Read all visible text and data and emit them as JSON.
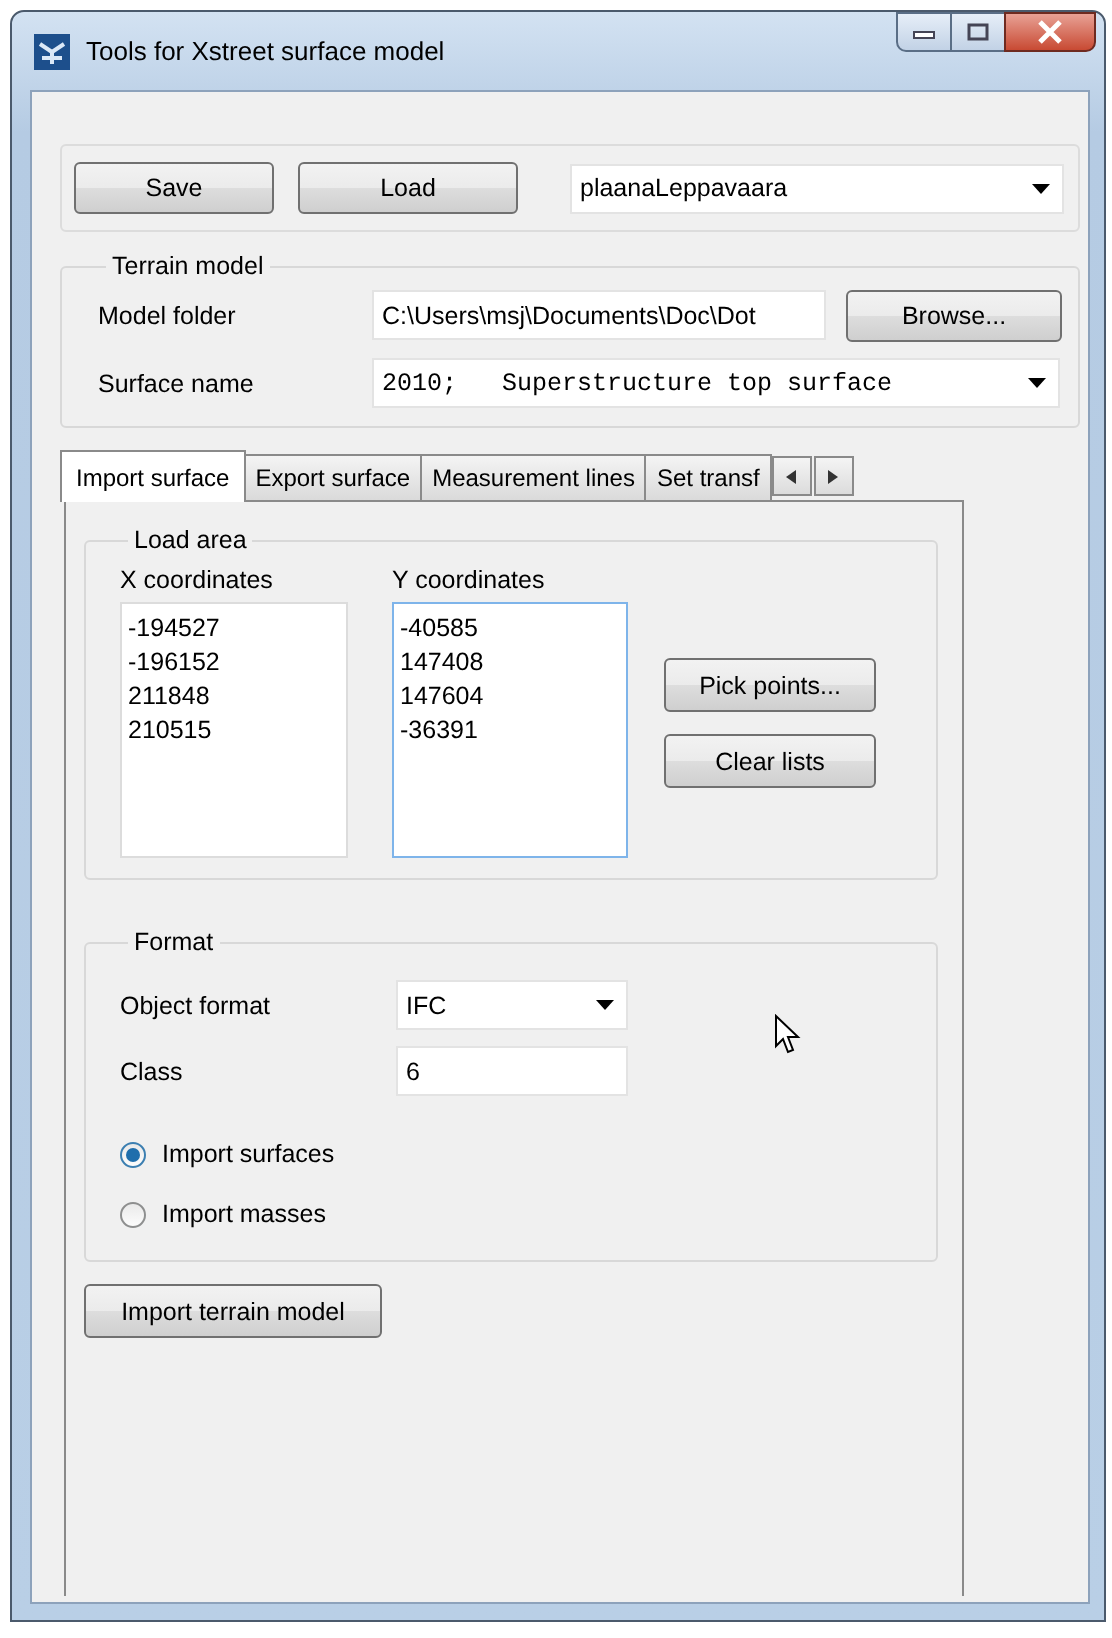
{
  "window": {
    "title": "Tools for Xstreet surface model"
  },
  "toolbar": {
    "buttons": [
      "Save",
      "Load"
    ],
    "profile": {
      "value": "plaanaLeppavaara"
    }
  },
  "terrain_model": {
    "title": "Terrain model",
    "fields": [
      {
        "kind": "text",
        "label": "Model folder",
        "value": "C:\\Users\\msj\\Documents\\Doc\\Dot",
        "button": "Browse..."
      },
      {
        "kind": "dropdown",
        "label": "Surface name",
        "value": "2010;   Superstructure top surface"
      }
    ]
  },
  "tabs": [
    {
      "label": "Import surface",
      "selected": true
    },
    {
      "label": "Export surface",
      "selected": false
    },
    {
      "label": "Measurement lines",
      "selected": false
    },
    {
      "label": "Set transf",
      "selected": false
    }
  ],
  "load_area": {
    "title": "Load area",
    "x_label": "X coordinates",
    "x_values": [
      "-194527",
      "-196152",
      "211848",
      "210515"
    ],
    "y_label": "Y coordinates",
    "y_values": [
      "-40585",
      "147408",
      "147604",
      "-36391"
    ],
    "buttons": [
      "Pick points...",
      "Clear lists"
    ]
  },
  "format": {
    "title": "Format",
    "fields": [
      {
        "kind": "dropdown",
        "label": "Object format",
        "value": "IFC"
      },
      {
        "kind": "text",
        "label": "Class",
        "value": "6"
      }
    ],
    "options": [
      {
        "label": "Import surfaces",
        "selected": true
      },
      {
        "label": "Import masses",
        "selected": false
      }
    ]
  },
  "action_button": "Import terrain model"
}
